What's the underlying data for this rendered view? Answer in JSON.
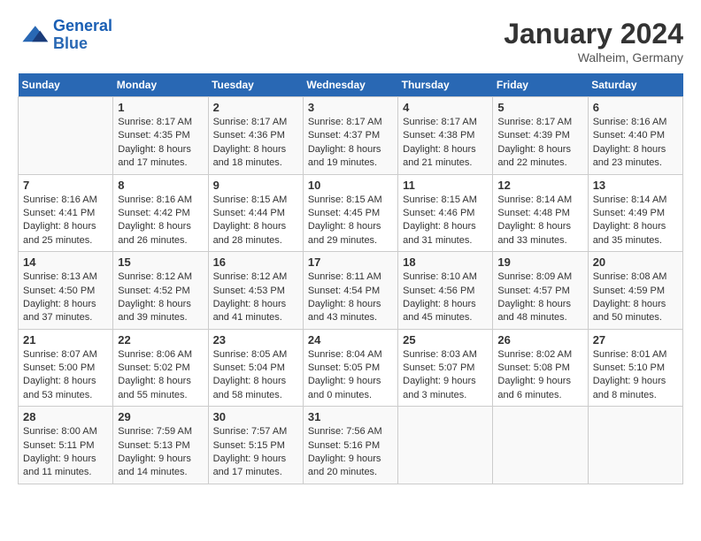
{
  "header": {
    "logo_general": "General",
    "logo_blue": "Blue",
    "month_year": "January 2024",
    "location": "Walheim, Germany"
  },
  "weekdays": [
    "Sunday",
    "Monday",
    "Tuesday",
    "Wednesday",
    "Thursday",
    "Friday",
    "Saturday"
  ],
  "weeks": [
    [
      {
        "day": "",
        "info": ""
      },
      {
        "day": "1",
        "info": "Sunrise: 8:17 AM\nSunset: 4:35 PM\nDaylight: 8 hours\nand 17 minutes."
      },
      {
        "day": "2",
        "info": "Sunrise: 8:17 AM\nSunset: 4:36 PM\nDaylight: 8 hours\nand 18 minutes."
      },
      {
        "day": "3",
        "info": "Sunrise: 8:17 AM\nSunset: 4:37 PM\nDaylight: 8 hours\nand 19 minutes."
      },
      {
        "day": "4",
        "info": "Sunrise: 8:17 AM\nSunset: 4:38 PM\nDaylight: 8 hours\nand 21 minutes."
      },
      {
        "day": "5",
        "info": "Sunrise: 8:17 AM\nSunset: 4:39 PM\nDaylight: 8 hours\nand 22 minutes."
      },
      {
        "day": "6",
        "info": "Sunrise: 8:16 AM\nSunset: 4:40 PM\nDaylight: 8 hours\nand 23 minutes."
      }
    ],
    [
      {
        "day": "7",
        "info": "Sunrise: 8:16 AM\nSunset: 4:41 PM\nDaylight: 8 hours\nand 25 minutes."
      },
      {
        "day": "8",
        "info": "Sunrise: 8:16 AM\nSunset: 4:42 PM\nDaylight: 8 hours\nand 26 minutes."
      },
      {
        "day": "9",
        "info": "Sunrise: 8:15 AM\nSunset: 4:44 PM\nDaylight: 8 hours\nand 28 minutes."
      },
      {
        "day": "10",
        "info": "Sunrise: 8:15 AM\nSunset: 4:45 PM\nDaylight: 8 hours\nand 29 minutes."
      },
      {
        "day": "11",
        "info": "Sunrise: 8:15 AM\nSunset: 4:46 PM\nDaylight: 8 hours\nand 31 minutes."
      },
      {
        "day": "12",
        "info": "Sunrise: 8:14 AM\nSunset: 4:48 PM\nDaylight: 8 hours\nand 33 minutes."
      },
      {
        "day": "13",
        "info": "Sunrise: 8:14 AM\nSunset: 4:49 PM\nDaylight: 8 hours\nand 35 minutes."
      }
    ],
    [
      {
        "day": "14",
        "info": "Sunrise: 8:13 AM\nSunset: 4:50 PM\nDaylight: 8 hours\nand 37 minutes."
      },
      {
        "day": "15",
        "info": "Sunrise: 8:12 AM\nSunset: 4:52 PM\nDaylight: 8 hours\nand 39 minutes."
      },
      {
        "day": "16",
        "info": "Sunrise: 8:12 AM\nSunset: 4:53 PM\nDaylight: 8 hours\nand 41 minutes."
      },
      {
        "day": "17",
        "info": "Sunrise: 8:11 AM\nSunset: 4:54 PM\nDaylight: 8 hours\nand 43 minutes."
      },
      {
        "day": "18",
        "info": "Sunrise: 8:10 AM\nSunset: 4:56 PM\nDaylight: 8 hours\nand 45 minutes."
      },
      {
        "day": "19",
        "info": "Sunrise: 8:09 AM\nSunset: 4:57 PM\nDaylight: 8 hours\nand 48 minutes."
      },
      {
        "day": "20",
        "info": "Sunrise: 8:08 AM\nSunset: 4:59 PM\nDaylight: 8 hours\nand 50 minutes."
      }
    ],
    [
      {
        "day": "21",
        "info": "Sunrise: 8:07 AM\nSunset: 5:00 PM\nDaylight: 8 hours\nand 53 minutes."
      },
      {
        "day": "22",
        "info": "Sunrise: 8:06 AM\nSunset: 5:02 PM\nDaylight: 8 hours\nand 55 minutes."
      },
      {
        "day": "23",
        "info": "Sunrise: 8:05 AM\nSunset: 5:04 PM\nDaylight: 8 hours\nand 58 minutes."
      },
      {
        "day": "24",
        "info": "Sunrise: 8:04 AM\nSunset: 5:05 PM\nDaylight: 9 hours\nand 0 minutes."
      },
      {
        "day": "25",
        "info": "Sunrise: 8:03 AM\nSunset: 5:07 PM\nDaylight: 9 hours\nand 3 minutes."
      },
      {
        "day": "26",
        "info": "Sunrise: 8:02 AM\nSunset: 5:08 PM\nDaylight: 9 hours\nand 6 minutes."
      },
      {
        "day": "27",
        "info": "Sunrise: 8:01 AM\nSunset: 5:10 PM\nDaylight: 9 hours\nand 8 minutes."
      }
    ],
    [
      {
        "day": "28",
        "info": "Sunrise: 8:00 AM\nSunset: 5:11 PM\nDaylight: 9 hours\nand 11 minutes."
      },
      {
        "day": "29",
        "info": "Sunrise: 7:59 AM\nSunset: 5:13 PM\nDaylight: 9 hours\nand 14 minutes."
      },
      {
        "day": "30",
        "info": "Sunrise: 7:57 AM\nSunset: 5:15 PM\nDaylight: 9 hours\nand 17 minutes."
      },
      {
        "day": "31",
        "info": "Sunrise: 7:56 AM\nSunset: 5:16 PM\nDaylight: 9 hours\nand 20 minutes."
      },
      {
        "day": "",
        "info": ""
      },
      {
        "day": "",
        "info": ""
      },
      {
        "day": "",
        "info": ""
      }
    ]
  ]
}
